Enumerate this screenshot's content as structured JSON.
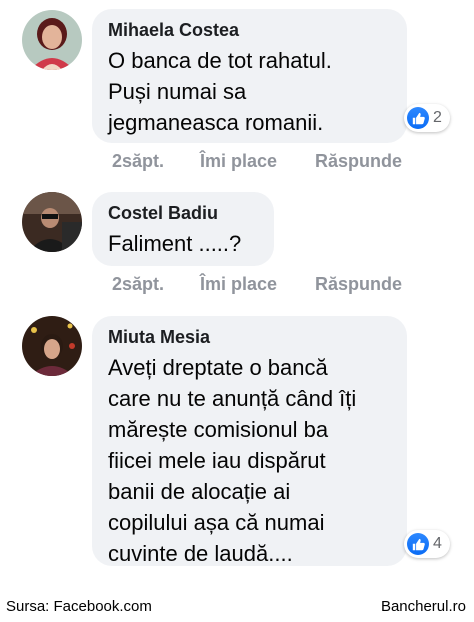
{
  "comments": [
    {
      "author": "Mihaela Costea",
      "text": "O banca de tot rahatul.\nPuși numai sa\njegmaneasca romanii.",
      "reaction_count": "2",
      "time": "2săpt.",
      "like": "Îmi place",
      "reply": "Răspunde"
    },
    {
      "author": "Costel Badiu",
      "text": "Faliment .....?",
      "time": "2săpt.",
      "like": "Îmi place",
      "reply": "Răspunde"
    },
    {
      "author": "Miuta Mesia",
      "text": "Aveți dreptate o bancă\ncare nu te anunță când îți\nmărește comisionul ba\nfiicei mele iau dispărut\nbanii de alocație ai\ncopilului așa că numai\ncuvinte de laudă....",
      "reaction_count": "4"
    }
  ],
  "footer": {
    "source": "Sursa: Facebook.com",
    "site": "Bancherul.ro"
  },
  "colors": {
    "bubble": "#f0f2f5",
    "like_blue": "#1877f2",
    "action_gray": "#90949c"
  }
}
